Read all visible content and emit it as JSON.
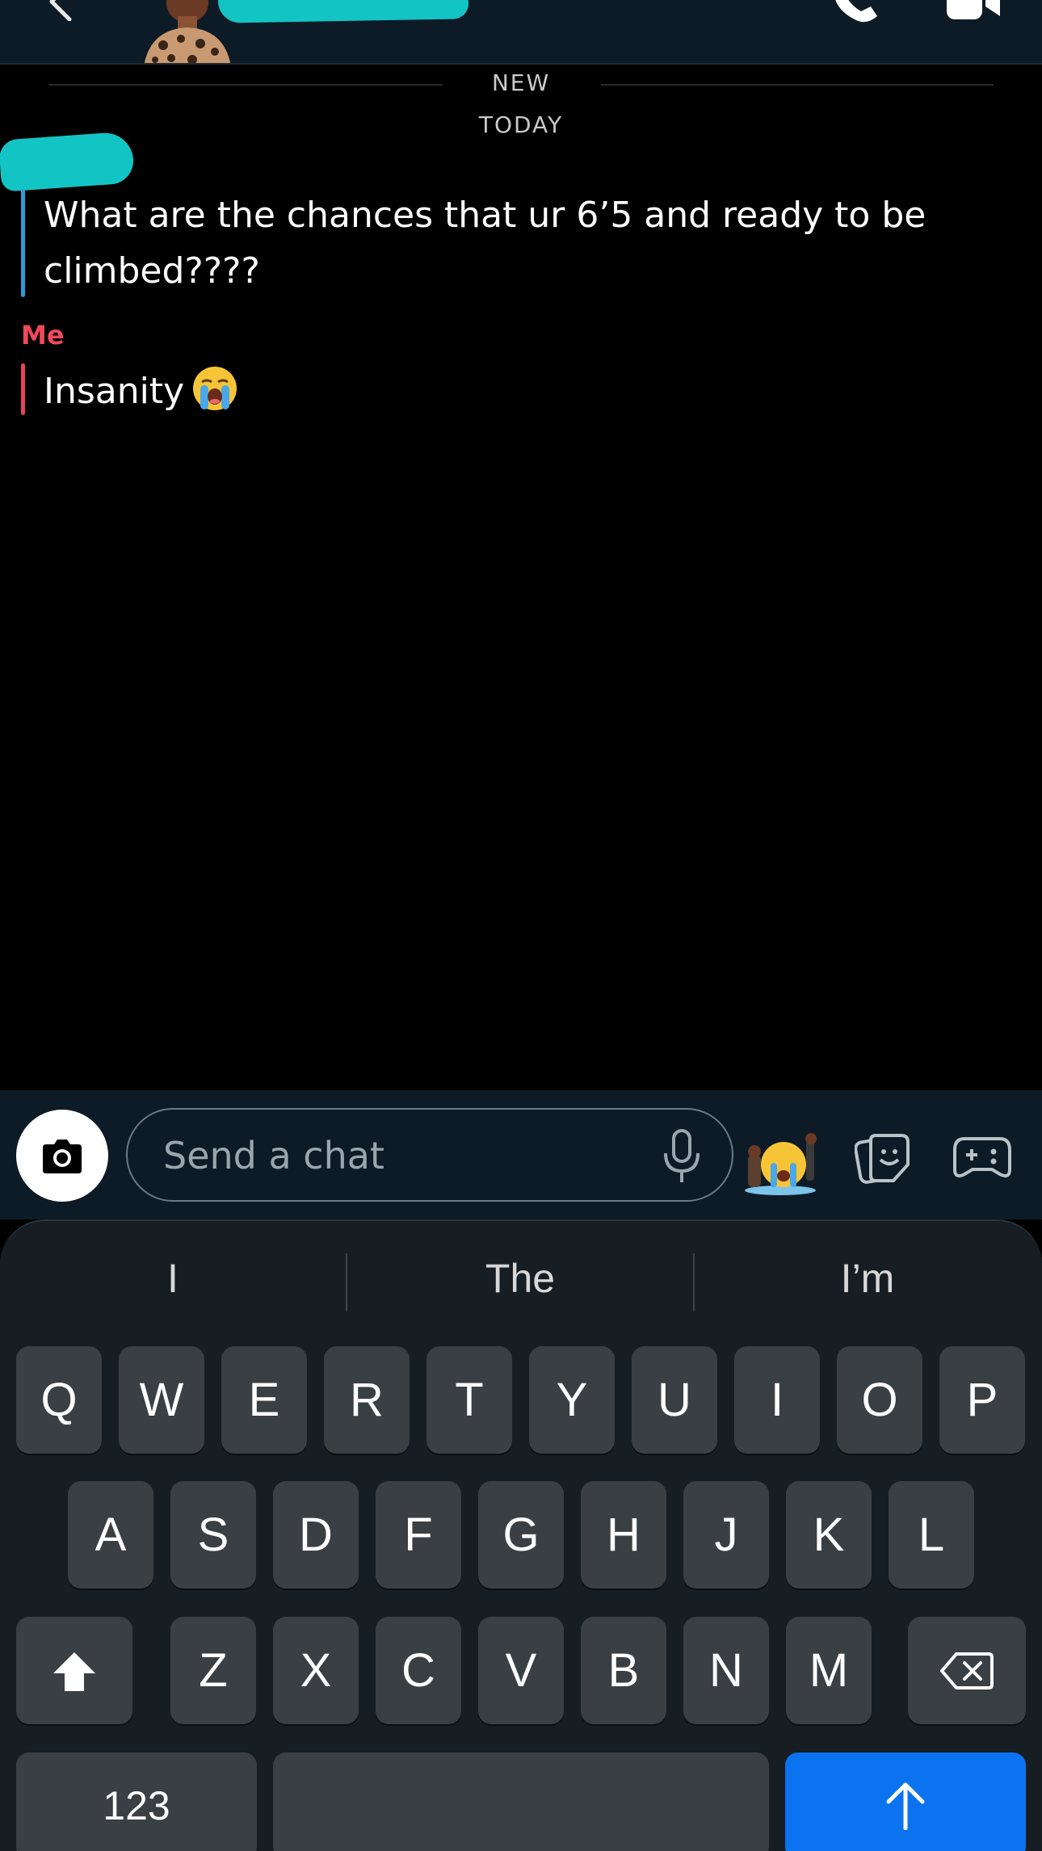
{
  "header": {
    "back_icon": "chevron-left-icon",
    "call_icon": "phone-icon",
    "video_icon": "video-camera-icon"
  },
  "thread": {
    "new_label": "NEW",
    "date_label": "TODAY",
    "messages": [
      {
        "sender": "",
        "text": "What are the chances that ur 6’5 and ready to be climbed????"
      },
      {
        "sender": "Me",
        "text": "Insanity"
      }
    ]
  },
  "composer": {
    "placeholder": "Send a chat",
    "camera_icon": "camera-icon",
    "mic_icon": "microphone-icon",
    "sticker_icon": "stickers-icon",
    "game_icon": "game-controller-icon"
  },
  "keyboard": {
    "suggestions": [
      "I",
      "The",
      "I’m"
    ],
    "row1": [
      "Q",
      "W",
      "E",
      "R",
      "T",
      "Y",
      "U",
      "I",
      "O",
      "P"
    ],
    "row2": [
      "A",
      "S",
      "D",
      "F",
      "G",
      "H",
      "J",
      "K",
      "L"
    ],
    "row3": [
      "Z",
      "X",
      "C",
      "V",
      "B",
      "N",
      "M"
    ],
    "numbers_label": "123",
    "shift_icon": "shift-icon",
    "delete_icon": "backspace-icon",
    "send_icon": "arrow-up-icon"
  },
  "colors": {
    "header_bg": "#0d1b26",
    "friend_accent": "#2e9bd9",
    "me_accent": "#f0485c",
    "send_button": "#0b73f0",
    "key_bg": "#3a3f44"
  }
}
